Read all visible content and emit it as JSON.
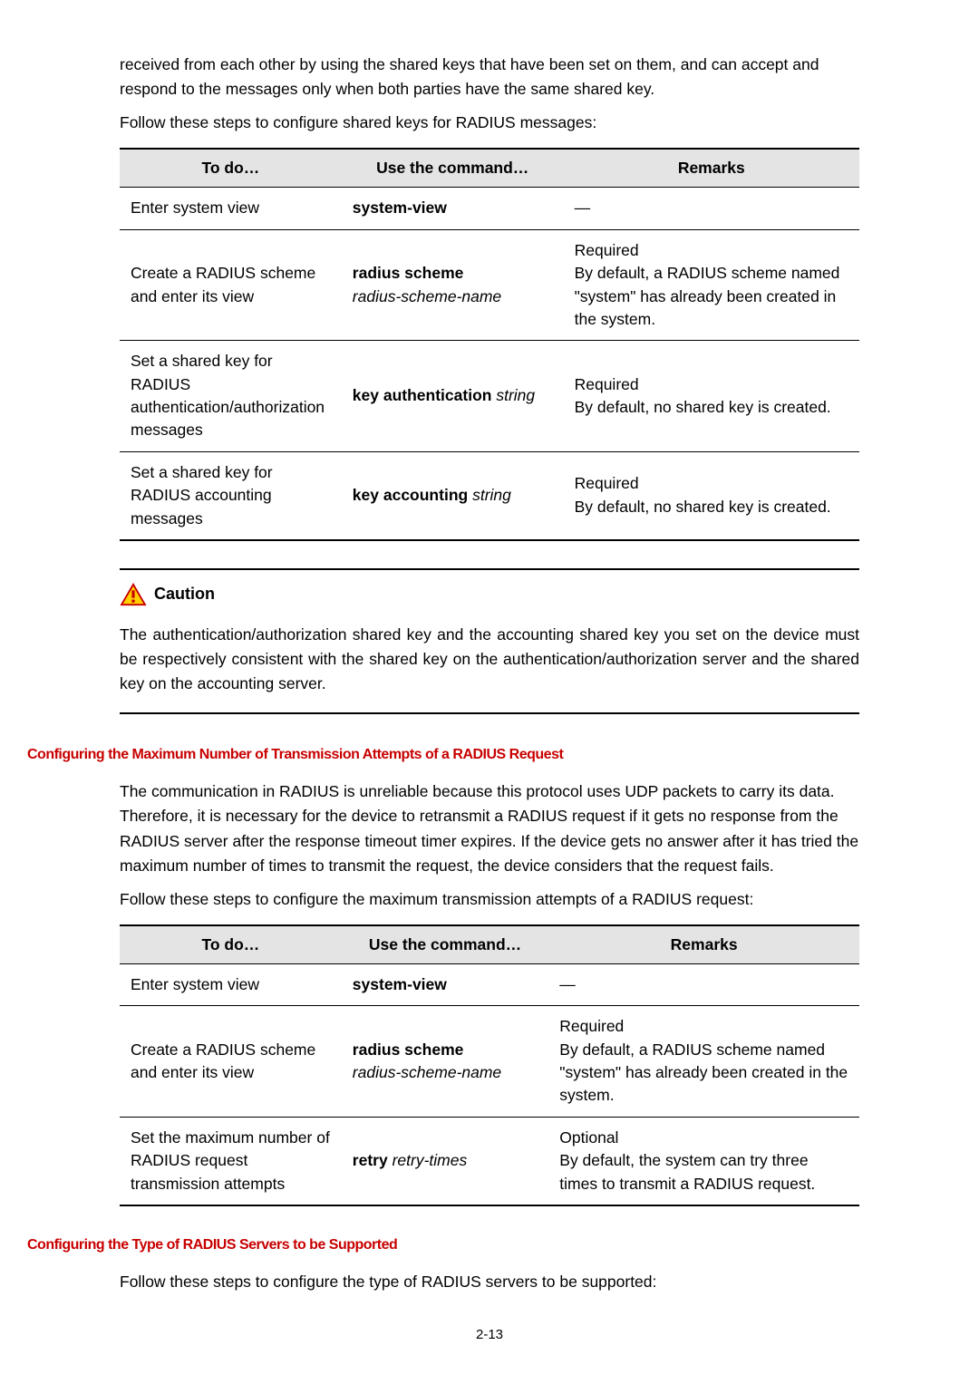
{
  "intro1": "received from each other by using the shared keys that have been set on them, and can accept and respond to the messages only when both parties have the same shared key.",
  "intro2": "Follow these steps to configure shared keys for RADIUS messages:",
  "table1": {
    "head": {
      "c1": "To do…",
      "c2": "Use the command…",
      "c3": "Remarks"
    },
    "rows": [
      {
        "c1": "Enter system view",
        "c2": "system-view",
        "c3": "—"
      },
      {
        "c1": "Create a RADIUS scheme and enter its view",
        "c2a": "radius scheme",
        "c2b": "radius-scheme-name",
        "c3a": "Required",
        "c3b": "By default, a RADIUS scheme named \"system\" has already been created in the system."
      },
      {
        "c1": "Set a shared key for RADIUS authentication/authorization messages",
        "c2a": "key authentication",
        "c2b": "string",
        "c3a": "Required",
        "c3b": "By default, no shared key is created."
      },
      {
        "c1": "Set a shared key for RADIUS accounting messages",
        "c2a": "key accounting",
        "c2b": "string",
        "c3a": "Required",
        "c3b": "By default, no shared key is created."
      }
    ]
  },
  "cautionLabel": "Caution",
  "cautionText": "The authentication/authorization shared key and the accounting shared key you set on the device must be respectively consistent with the shared key on the authentication/authorization server and the shared key on the accounting server.",
  "section1Heading": "Configuring the Maximum Number of Transmission Attempts of a RADIUS Request",
  "section1p1": "The communication in RADIUS is unreliable because this protocol uses UDP packets to carry its data. Therefore, it is necessary for the device to retransmit a RADIUS request if it gets no response from the RADIUS server after the response timeout timer expires. If the device gets no answer after it has tried the maximum number of times to transmit the request, the device considers that the request fails.",
  "section1p2": "Follow these steps to configure the maximum transmission attempts of a RADIUS request:",
  "table2": {
    "head": {
      "c1": "To do…",
      "c2": "Use the command…",
      "c3": "Remarks"
    },
    "rows": [
      {
        "c1": "Enter system view",
        "c2": "system-view",
        "c3": "—"
      },
      {
        "c1": "Create a RADIUS scheme and enter its view",
        "c2a": "radius scheme",
        "c2b": "radius-scheme-name",
        "c3a": "Required",
        "c3b": "By default, a RADIUS scheme named \"system\" has already been created in the system."
      },
      {
        "c1": "Set the maximum number of RADIUS request transmission attempts",
        "c2a": "retry",
        "c2b": "retry-times",
        "c3a": "Optional",
        "c3b": "By default, the system can try three times to transmit a RADIUS request."
      }
    ]
  },
  "section2Heading": "Configuring the Type of RADIUS Servers to be Supported",
  "section2p1": "Follow these steps to configure the type of RADIUS servers to be supported:",
  "pageNum": "2-13"
}
